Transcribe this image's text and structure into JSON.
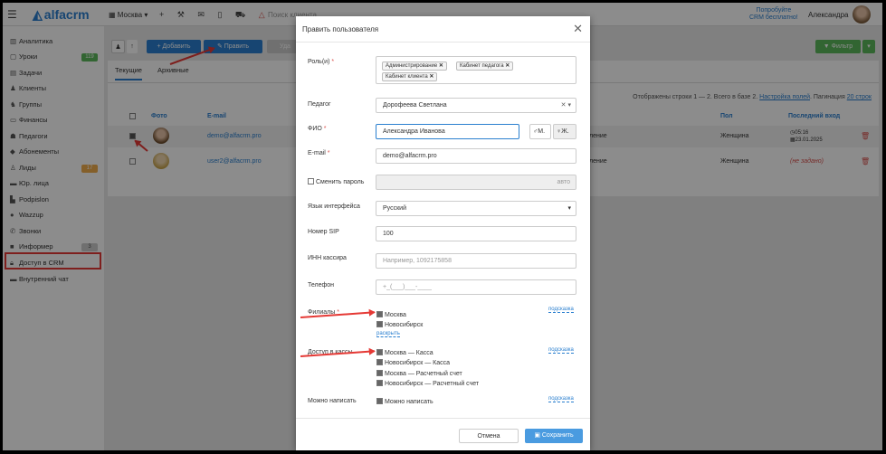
{
  "topbar": {
    "menu_icon": "menu-icon",
    "logo": "alfacrm",
    "city": "Москва",
    "search_placeholder": "Поиск клиента...",
    "promo_line1": "Попробуйте",
    "promo_line2": "CRM бесплатно!",
    "user_name": "Александра"
  },
  "sidebar": {
    "items": [
      {
        "label": "Аналитика",
        "icon": "chart-icon"
      },
      {
        "label": "Уроки",
        "icon": "calendar-icon",
        "badge": "119"
      },
      {
        "label": "Задачи",
        "icon": "tasks-icon"
      },
      {
        "label": "Клиенты",
        "icon": "user-icon"
      },
      {
        "label": "Группы",
        "icon": "group-icon"
      },
      {
        "label": "Финансы",
        "icon": "money-icon"
      },
      {
        "label": "Педагоги",
        "icon": "teacher-icon"
      },
      {
        "label": "Абонементы",
        "icon": "tag-icon"
      },
      {
        "label": "Лиды",
        "icon": "leads-icon",
        "badge": "17"
      },
      {
        "label": "Юр. лица",
        "icon": "building-icon"
      },
      {
        "label": "Podpislon",
        "icon": "document-icon"
      },
      {
        "label": "Wazzup",
        "icon": "chat-icon"
      },
      {
        "label": "Звонки",
        "icon": "phone-icon"
      },
      {
        "label": "Информер",
        "icon": "informer-icon",
        "badge": "3"
      },
      {
        "label": "Доступ в CRM",
        "icon": "lock-icon"
      },
      {
        "label": "Внутренний чат",
        "icon": "message-icon"
      }
    ]
  },
  "toolbar": {
    "add_label": "+ Добавить",
    "edit_label": "✎ Править",
    "delete_label": "Уда",
    "filter_label": "▼ Фильтр"
  },
  "tabs": [
    "Текущие",
    "Архивные"
  ],
  "info": {
    "shown": "Отображены строки 1 — 2. Всего в базе 2.",
    "settings": "Настройка полей",
    "paging": ". Пагинация",
    "per_page": "20 строк"
  },
  "table": {
    "headers": [
      "Фото",
      "E-mail",
      "Пол",
      "Последний вход"
    ],
    "rows": [
      {
        "email": "demo@alfacrm.pro",
        "role": "ление",
        "gender": "Женщина",
        "last_time": "05:16",
        "last_date": "23.01.2025",
        "checked": true
      },
      {
        "email": "user2@alfacrm.pro",
        "role": "ление",
        "gender": "Женщина",
        "last_login": "(не задано)",
        "checked": false
      }
    ]
  },
  "modal": {
    "title": "Править пользователя",
    "roles_label": "Роль(и)",
    "roles": [
      "Администрирование",
      "Кабинет педагога",
      "Кабинет клиента"
    ],
    "teacher_label": "Педагог",
    "teacher_value": "Дорофеева Светлана",
    "fio_label": "ФИО",
    "fio_value": "Александра Иванова",
    "gender_m": "М.",
    "gender_f": "Ж.",
    "email_label": "E-mail",
    "email_value": "demo@alfacrm.pro",
    "change_pw_label": "Сменить пароль",
    "pw_auto": "авто",
    "lang_label": "Язык интерфейса",
    "lang_value": "Русский",
    "sip_label": "Номер SIP",
    "sip_value": "100",
    "inn_label": "ИНН кассира",
    "inn_placeholder": "Например, 1092175858",
    "phone_label": "Телефон",
    "phone_placeholder": "+_(___)___-____",
    "branches_label": "Филиалы",
    "branches": [
      "Москва",
      "Новосибирск"
    ],
    "expand": "раскрыть",
    "hint": "подсказка",
    "cash_label": "Доступ в кассы",
    "cash": [
      "Москва — Касса",
      "Новосибирск — Касса",
      "Москва — Расчетный счет",
      "Новосибирск — Расчетный счет"
    ],
    "can_write_label": "Можно написать",
    "can_write_value": "Можно написать",
    "cancel": "Отмена",
    "save": "Сохранить"
  },
  "colors": {
    "accent": "#2a7fcf",
    "green": "#5cb85c",
    "danger": "#e53935"
  }
}
